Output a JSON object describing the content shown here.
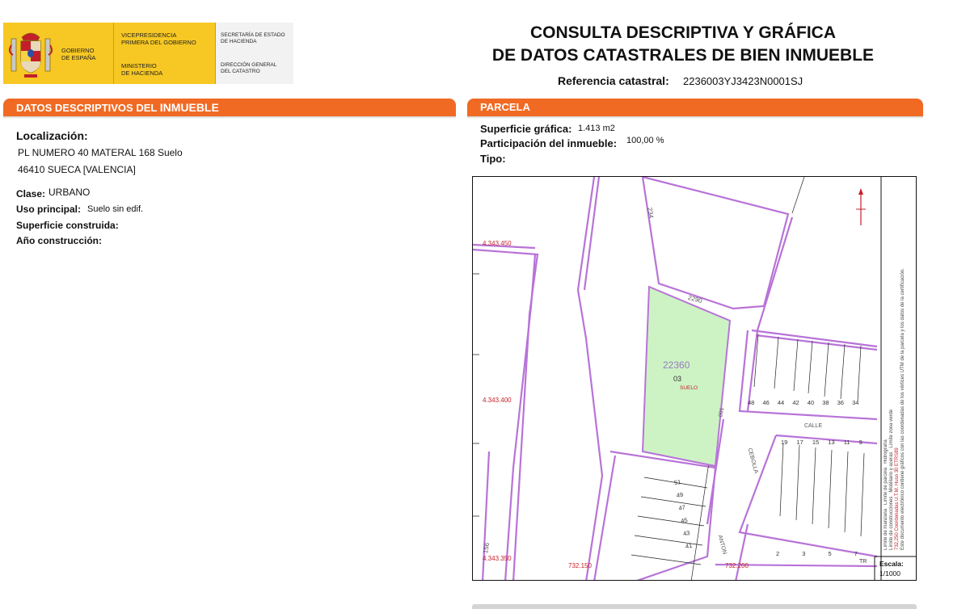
{
  "header": {
    "gobierno": [
      "GOBIERNO",
      "DE ESPAÑA"
    ],
    "vicepresidencia": [
      "VICEPRESIDENCIA",
      "PRIMERA DEL GOBIERNO"
    ],
    "ministerio": [
      "MINISTERIO",
      "DE HACIENDA"
    ],
    "secretaria": [
      "SECRETARÍA DE ESTADO",
      "DE HACIENDA"
    ],
    "direccion": [
      "DIRECCIÓN GENERAL",
      "DEL CATASTRO"
    ],
    "title_line1": "CONSULTA DESCRIPTIVA Y GRÁFICA",
    "title_line2": "DE DATOS CATASTRALES DE BIEN INMUEBLE",
    "ref_label": "Referencia catastral:",
    "ref_value": "2236003YJ3423N0001SJ",
    "colors": {
      "logo_yellow": "#f7c823",
      "logo_grey": "#f2f2f2",
      "accent_orange": "#f06a24"
    },
    "shield_icon": "spain-coat-of-arms"
  },
  "left": {
    "bar_title_a": "DATOS DESCRIPTIVOS DEL ",
    "bar_title_b": "INMUEBLE",
    "loc_label": "Localización:",
    "loc_line1": "PL NUMERO  40 MATERAL 168 Suelo",
    "loc_line2": "46410 SUECA [VALENCIA]",
    "clase_label": "Clase:",
    "clase_value": "URBANO",
    "uso_label": "Uso principal:",
    "uso_value": "Suelo sin edif.",
    "sup_label": "Superficie construida:",
    "anio_label": "Año construcción:"
  },
  "right": {
    "bar_title": "PARCELA",
    "sup_label": "Superficie gráfica:",
    "sup_value": "1.413 m2",
    "part_label": "Participación del inmueble:",
    "part_value": "100,00 %",
    "tipo_label": "Tipo:"
  },
  "map": {
    "parcel_number": "22360",
    "parcel_sub": "03",
    "parcel_use": "SUELO",
    "coord_top": "4.343.450",
    "coord_mid": "4.343.400",
    "coord_bottom": "4.343.350",
    "coord_x1": "732.150",
    "coord_x2": "732.200",
    "parcel_2290": "2290",
    "parcel_234": "234",
    "parcel_156": "156",
    "parcel_001": "001",
    "street_calle": "CALLE",
    "street_cebolla": "CEBOLLA",
    "street_anton": "ANTON",
    "row_top_nums": [
      "48",
      "46",
      "44",
      "42",
      "40",
      "38",
      "36",
      "34"
    ],
    "row_right_nums": [
      "19",
      "17",
      "15",
      "13",
      "11",
      "9"
    ],
    "row_bottom_nums": [
      "2",
      "3",
      "5",
      "7"
    ],
    "col_left_nums": [
      "51",
      "49",
      "47",
      "45",
      "43",
      "41"
    ],
    "tr_label": "TR",
    "scale_label": "Escala:",
    "scale_value": "1/1000",
    "legend_line1": "Límite de manzana",
    "legend_line2": "Límite de parcela",
    "legend_line3": "Hidrografía",
    "legend_line4": "Límite de construcciones",
    "legend_line5": "Mobiliario y aceras",
    "legend_line6": "Límite zona verde",
    "legend_coords": "732,250 Coordenadas U.T.M. Huso 30 ETRS89",
    "legend_note": "Este documento electrónico contiene gráficos con las coordenadas de los vértices UTM de la parcela y los datos de la certificación.",
    "colors": {
      "parcel_fill": "#cdf3c4",
      "boundary": "#b873d8",
      "coord_red": "#c8202a"
    }
  }
}
